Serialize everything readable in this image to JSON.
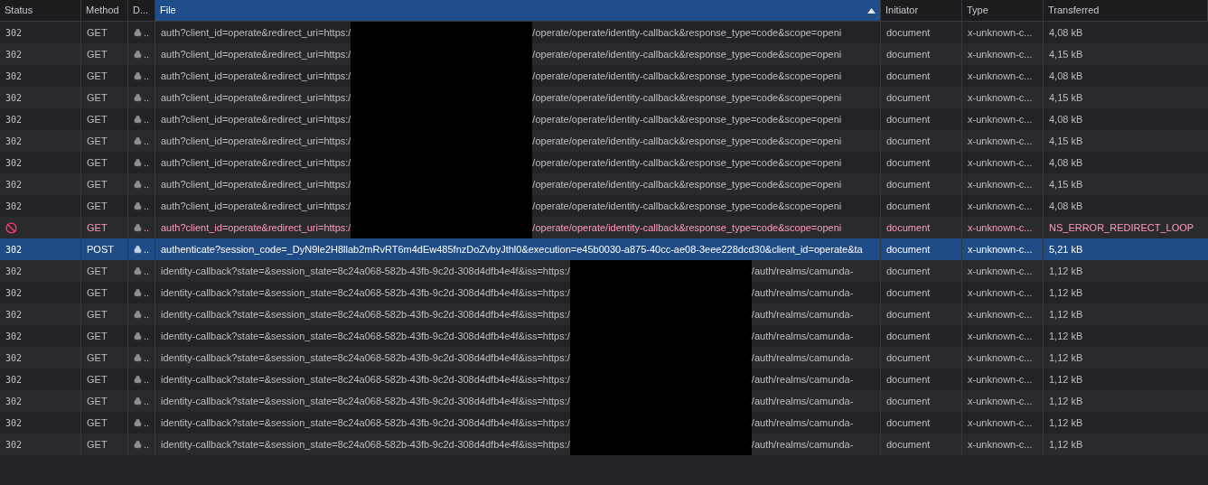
{
  "columns": [
    {
      "label": "Status",
      "selected": false
    },
    {
      "label": "Method",
      "selected": false
    },
    {
      "label": "D...",
      "selected": false
    },
    {
      "label": "File",
      "selected": true,
      "sorted_ascending": true
    },
    {
      "label": "Initiator",
      "selected": false
    },
    {
      "label": "Type",
      "selected": false
    },
    {
      "label": "Transferred",
      "selected": false
    }
  ],
  "rows": [
    {
      "status": "302",
      "error": false,
      "selected": false,
      "method": "GET",
      "domain": "..",
      "file_start": "auth?client_id=operate&redirect_uri=https:/",
      "redacted": true,
      "file_end": "/operate/operate/identity-callback&response_type=code&scope=openi",
      "initiator": "document",
      "type": "x-unknown-c...",
      "transferred": "4,08 kB"
    },
    {
      "status": "302",
      "error": false,
      "selected": false,
      "method": "GET",
      "domain": "..",
      "file_start": "auth?client_id=operate&redirect_uri=https:/",
      "redacted": true,
      "file_end": "/operate/operate/identity-callback&response_type=code&scope=openi",
      "initiator": "document",
      "type": "x-unknown-c...",
      "transferred": "4,15 kB"
    },
    {
      "status": "302",
      "error": false,
      "selected": false,
      "method": "GET",
      "domain": "..",
      "file_start": "auth?client_id=operate&redirect_uri=https:/",
      "redacted": true,
      "file_end": "/operate/operate/identity-callback&response_type=code&scope=openi",
      "initiator": "document",
      "type": "x-unknown-c...",
      "transferred": "4,08 kB"
    },
    {
      "status": "302",
      "error": false,
      "selected": false,
      "method": "GET",
      "domain": "..",
      "file_start": "auth?client_id=operate&redirect_uri=https:/",
      "redacted": true,
      "file_end": "/operate/operate/identity-callback&response_type=code&scope=openi",
      "initiator": "document",
      "type": "x-unknown-c...",
      "transferred": "4,15 kB"
    },
    {
      "status": "302",
      "error": false,
      "selected": false,
      "method": "GET",
      "domain": "..",
      "file_start": "auth?client_id=operate&redirect_uri=https:/",
      "redacted": true,
      "file_end": "/operate/operate/identity-callback&response_type=code&scope=openi",
      "initiator": "document",
      "type": "x-unknown-c...",
      "transferred": "4,08 kB"
    },
    {
      "status": "302",
      "error": false,
      "selected": false,
      "method": "GET",
      "domain": "..",
      "file_start": "auth?client_id=operate&redirect_uri=https:/",
      "redacted": true,
      "file_end": "/operate/operate/identity-callback&response_type=code&scope=openi",
      "initiator": "document",
      "type": "x-unknown-c...",
      "transferred": "4,15 kB"
    },
    {
      "status": "302",
      "error": false,
      "selected": false,
      "method": "GET",
      "domain": "..",
      "file_start": "auth?client_id=operate&redirect_uri=https:/",
      "redacted": true,
      "file_end": "/operate/operate/identity-callback&response_type=code&scope=openi",
      "initiator": "document",
      "type": "x-unknown-c...",
      "transferred": "4,08 kB"
    },
    {
      "status": "302",
      "error": false,
      "selected": false,
      "method": "GET",
      "domain": "..",
      "file_start": "auth?client_id=operate&redirect_uri=https:/",
      "redacted": true,
      "file_end": "/operate/operate/identity-callback&response_type=code&scope=openi",
      "initiator": "document",
      "type": "x-unknown-c...",
      "transferred": "4,15 kB"
    },
    {
      "status": "302",
      "error": false,
      "selected": false,
      "method": "GET",
      "domain": "..",
      "file_start": "auth?client_id=operate&redirect_uri=https:/",
      "redacted": true,
      "file_end": "/operate/operate/identity-callback&response_type=code&scope=openi",
      "initiator": "document",
      "type": "x-unknown-c...",
      "transferred": "4,08 kB"
    },
    {
      "error": true,
      "selected": false,
      "method": "GET",
      "domain": "..",
      "file_start": "auth?client_id=operate&redirect_uri=https:/",
      "redacted": true,
      "file_end": "/operate/operate/identity-callback&response_type=code&scope=openi",
      "initiator": "document",
      "type": "x-unknown-c...",
      "transferred": "NS_ERROR_REDIRECT_LOOP"
    },
    {
      "status": "302",
      "error": false,
      "selected": true,
      "method": "POST",
      "domain": "..",
      "file_start": "authenticate?session_code=_DyN9le2H8llab2mRvRT6m4dEw485fnzDoZvbyJthl0&execution=e45b0030-a875-40cc-ae08-3eee228dcd30&client_id=operate&ta",
      "redacted": false,
      "initiator": "document",
      "type": "x-unknown-c...",
      "transferred": "5,21 kB"
    },
    {
      "status": "302",
      "error": false,
      "selected": false,
      "method": "GET",
      "domain": "..",
      "file_start": "identity-callback?state=&session_state=8c24a068-582b-43fb-9c2d-308d4dfb4e4f&iss=https:/",
      "redacted": true,
      "file_end": "/auth/realms/camunda-",
      "initiator": "document",
      "type": "x-unknown-c...",
      "transferred": "1,12 kB"
    },
    {
      "status": "302",
      "error": false,
      "selected": false,
      "method": "GET",
      "domain": "..",
      "file_start": "identity-callback?state=&session_state=8c24a068-582b-43fb-9c2d-308d4dfb4e4f&iss=https:/",
      "redacted": true,
      "file_end": "/auth/realms/camunda-",
      "initiator": "document",
      "type": "x-unknown-c...",
      "transferred": "1,12 kB"
    },
    {
      "status": "302",
      "error": false,
      "selected": false,
      "method": "GET",
      "domain": "..",
      "file_start": "identity-callback?state=&session_state=8c24a068-582b-43fb-9c2d-308d4dfb4e4f&iss=https:/",
      "redacted": true,
      "file_end": "/auth/realms/camunda-",
      "initiator": "document",
      "type": "x-unknown-c...",
      "transferred": "1,12 kB"
    },
    {
      "status": "302",
      "error": false,
      "selected": false,
      "method": "GET",
      "domain": "..",
      "file_start": "identity-callback?state=&session_state=8c24a068-582b-43fb-9c2d-308d4dfb4e4f&iss=https:/",
      "redacted": true,
      "file_end": "/auth/realms/camunda-",
      "initiator": "document",
      "type": "x-unknown-c...",
      "transferred": "1,12 kB"
    },
    {
      "status": "302",
      "error": false,
      "selected": false,
      "method": "GET",
      "domain": "..",
      "file_start": "identity-callback?state=&session_state=8c24a068-582b-43fb-9c2d-308d4dfb4e4f&iss=https:/",
      "redacted": true,
      "file_end": "/auth/realms/camunda-",
      "initiator": "document",
      "type": "x-unknown-c...",
      "transferred": "1,12 kB"
    },
    {
      "status": "302",
      "error": false,
      "selected": false,
      "method": "GET",
      "domain": "..",
      "file_start": "identity-callback?state=&session_state=8c24a068-582b-43fb-9c2d-308d4dfb4e4f&iss=https:/",
      "redacted": true,
      "file_end": "/auth/realms/camunda-",
      "initiator": "document",
      "type": "x-unknown-c...",
      "transferred": "1,12 kB"
    },
    {
      "status": "302",
      "error": false,
      "selected": false,
      "method": "GET",
      "domain": "..",
      "file_start": "identity-callback?state=&session_state=8c24a068-582b-43fb-9c2d-308d4dfb4e4f&iss=https:/",
      "redacted": true,
      "file_end": "/auth/realms/camunda-",
      "initiator": "document",
      "type": "x-unknown-c...",
      "transferred": "1,12 kB"
    },
    {
      "status": "302",
      "error": false,
      "selected": false,
      "method": "GET",
      "domain": "..",
      "file_start": "identity-callback?state=&session_state=8c24a068-582b-43fb-9c2d-308d4dfb4e4f&iss=https:/",
      "redacted": true,
      "file_end": "/auth/realms/camunda-",
      "initiator": "document",
      "type": "x-unknown-c...",
      "transferred": "1,12 kB"
    },
    {
      "status": "302",
      "error": false,
      "selected": false,
      "method": "GET",
      "domain": "..",
      "file_start": "identity-callback?state=&session_state=8c24a068-582b-43fb-9c2d-308d4dfb4e4f&iss=https:/",
      "redacted": true,
      "file_end": "/auth/realms/camunda-",
      "initiator": "document",
      "type": "x-unknown-c...",
      "transferred": "1,12 kB"
    }
  ]
}
